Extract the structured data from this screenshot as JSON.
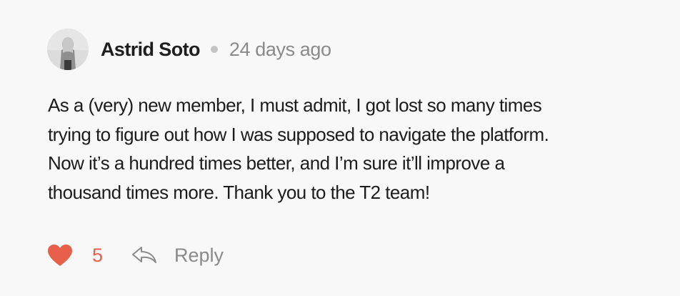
{
  "comment": {
    "author": "Astrid Soto",
    "timestamp": "24 days ago",
    "avatar_icon": "user-photo-avatar",
    "body_lines": [
      "As a (very) new member, I must admit, I got lost so many times",
      "trying to figure out how I was supposed to navigate the platform.",
      "Now it’s a hundred times better, and I’m sure it’ll improve a",
      "thousand times more. Thank you to the T2 team!"
    ],
    "likes": "5",
    "reply_label": "Reply",
    "like_icon": "heart-icon",
    "reply_icon": "reply-arrow-icon"
  },
  "colors": {
    "background": "#f8f8f8",
    "like_accent": "#e8604c",
    "muted_text": "#8a8a8a",
    "separator_dot": "#c4c4c4"
  }
}
